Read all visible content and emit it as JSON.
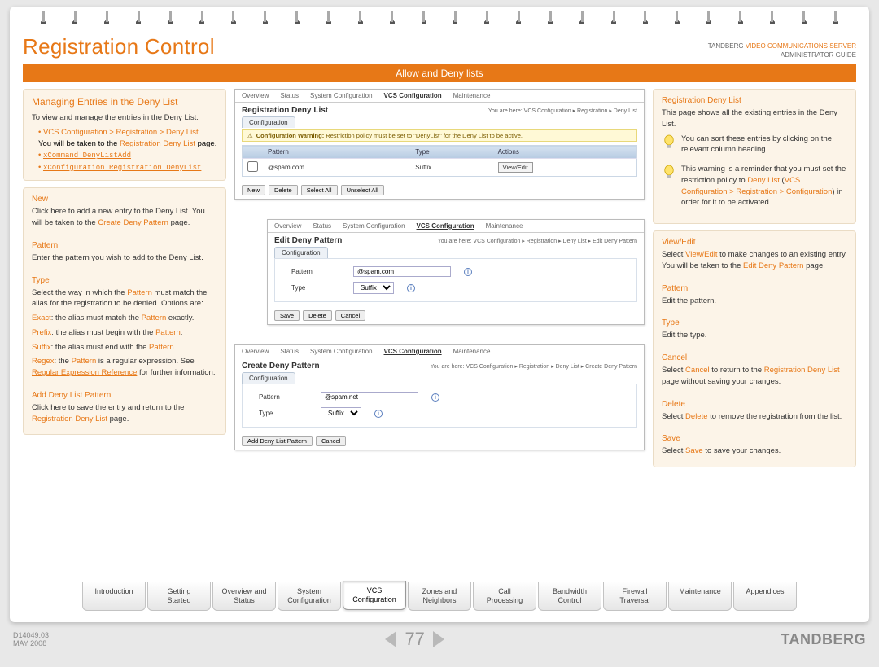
{
  "brand": {
    "line1": "TANDBERG",
    "product": "VIDEO COMMUNICATIONS SERVER",
    "line2": "ADMINISTRATOR GUIDE"
  },
  "page_title": "Registration Control",
  "subtitle": "Allow and Deny lists",
  "left": {
    "h": "Managing Entries in the Deny List",
    "intro": "To view and manage the entries in the Deny List:",
    "bul1": "VCS Configuration > Registration > Deny List",
    "bul1b_a": "You will be taken to the ",
    "bul1b_b": "Registration Deny List",
    "bul1b_c": " page.",
    "cmd1": "xCommand DenyListAdd",
    "cmd2": "xConfiguration Registration DenyList",
    "new_h": "New",
    "new_p1": "Click here to add a new entry to the Deny List. You will be taken to the ",
    "new_kw": "Create Deny Pattern",
    "new_p2": " page.",
    "pat_h": "Pattern",
    "pat_p": "Enter the pattern you wish to add to the Deny List.",
    "type_h": "Type",
    "type_intro": "Select the way in which the ",
    "type_kw": "Pattern",
    "type_p2": " must match the alias for the registration to be denied. Options are:",
    "exact_k": "Exact",
    "exact_t": ": the alias must match the ",
    "exact_k2": "Pattern",
    "exact_t2": " exactly.",
    "prefix_k": "Prefix",
    "prefix_t": ": the alias must begin with the ",
    "prefix_k2": "Pattern",
    "prefix_t2": ".",
    "suffix_k": "Suffix",
    "suffix_t": ": the alias must end with the ",
    "suffix_k2": "Pattern",
    "suffix_t2": ".",
    "regex_k": "Regex",
    "regex_t": ": the ",
    "regex_k2": "Pattern",
    "regex_t2": " is a regular expression. See ",
    "regex_l": "Regular Expression Reference",
    "regex_t3": " for further information.",
    "add_h": "Add Deny List Pattern",
    "add_p1": "Click here to save the entry and return to the ",
    "add_kw": "Registration Deny List",
    "add_p2": " page."
  },
  "right": {
    "rdl_h": "Registration Deny List",
    "rdl_p": "This page shows all the existing entries in the Deny List.",
    "tip1": "You can sort these entries by clicking on the relevant column heading.",
    "tip2_a": "This warning is a reminder that you must set the restriction policy to ",
    "tip2_kw1": "Deny List",
    "tip2_b": " (",
    "tip2_kw2": "VCS Configuration > Registration > Configuration",
    "tip2_c": ") in order for it to be activated.",
    "ve_h": "View/Edit",
    "ve_a": "Select ",
    "ve_kw": "View/Edit",
    "ve_b": " to make changes to an existing entry. You will be taken to the ",
    "ve_kw2": "Edit Deny Pattern",
    "ve_c": " page.",
    "rp_h": "Pattern",
    "rp_t": "Edit the pattern.",
    "rt_h": "Type",
    "rt_t": "Edit the type.",
    "rc_h": "Cancel",
    "rc_a": "Select ",
    "rc_kw": "Cancel",
    "rc_b": " to return to the ",
    "rc_kw2": "Registration Deny List",
    "rc_c": " page without saving your changes.",
    "rd_h": "Delete",
    "rd_a": "Select ",
    "rd_kw": "Delete",
    "rd_b": " to remove the registration from the list.",
    "rs_h": "Save",
    "rs_a": "Select ",
    "rs_kw": "Save",
    "rs_b": " to save your changes."
  },
  "scr": {
    "nav": [
      "Overview",
      "Status",
      "System Configuration",
      "VCS Configuration",
      "Maintenance"
    ],
    "curr": "VCS Configuration",
    "cfg_tab": "Configuration",
    "rdl": {
      "title": "Registration Deny List",
      "bc": "You are here: VCS Configuration ▸ Registration ▸ Deny List",
      "warn_label": "Configuration Warning:",
      "warn_txt": " Restriction policy must be set to \"DenyList\" for the Deny List to be active.",
      "th_p": "Pattern",
      "th_t": "Type",
      "th_a": "Actions",
      "row_p": "@spam.com",
      "row_t": "Suffix",
      "row_a": "View/Edit",
      "b_new": "New",
      "b_del": "Delete",
      "b_sa": "Select All",
      "b_ua": "Unselect All"
    },
    "edit": {
      "title": "Edit Deny Pattern",
      "bc": "You are here: VCS Configuration ▸ Registration ▸ Deny List ▸ Edit Deny Pattern",
      "l_pat": "Pattern",
      "v_pat": "@spam.com",
      "l_type": "Type",
      "v_type": "Suffix",
      "b_save": "Save",
      "b_del": "Delete",
      "b_cancel": "Cancel"
    },
    "create": {
      "title": "Create Deny Pattern",
      "bc": "You are here: VCS Configuration ▸ Registration ▸ Deny List ▸ Create Deny Pattern",
      "l_pat": "Pattern",
      "v_pat": "@spam.net",
      "l_type": "Type",
      "v_type": "Suffix",
      "b_add": "Add Deny List Pattern",
      "b_cancel": "Cancel"
    }
  },
  "tabs": [
    "Introduction",
    "Getting Started",
    "Overview and Status",
    "System Configuration",
    "VCS Configuration",
    "Zones and Neighbors",
    "Call Processing",
    "Bandwidth Control",
    "Firewall Traversal",
    "Maintenance",
    "Appendices"
  ],
  "active_tab": "VCS Configuration",
  "footer": {
    "ref": "D14049.03",
    "date": "MAY 2008",
    "page": "77",
    "logo": "TANDBERG"
  }
}
